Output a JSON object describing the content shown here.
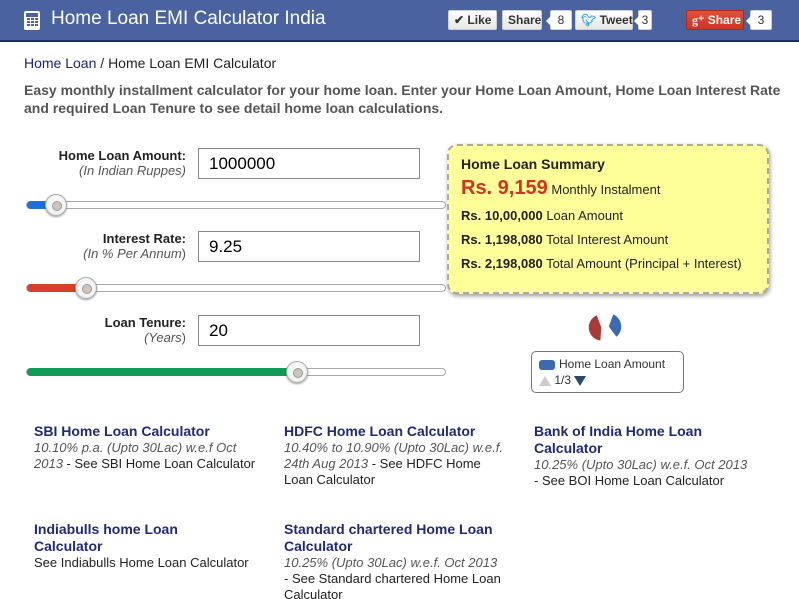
{
  "header": {
    "title": "Home Loan EMI Calculator India",
    "icon": "calculator-icon",
    "social": {
      "like_label": "Like",
      "fb_share_label": "Share",
      "fb_count": "8",
      "tweet_label": "Tweet",
      "tweet_count": "3",
      "gplus_label": "Share",
      "gplus_count": "3"
    }
  },
  "breadcrumb": {
    "home": "Home Loan",
    "separator": " / ",
    "current": "Home Loan EMI Calculator"
  },
  "intro": "Easy monthly installment calculator for your home loan. Enter your Home Loan Amount, Home Loan Interest Rate and required Loan Tenure to see detail home loan calculations.",
  "fields": {
    "amount": {
      "label": "Home Loan Amount:",
      "sub": "(In Indian Ruppes)",
      "value": "1000000",
      "slider_fraction": 0.07,
      "color": "#1e6fd9"
    },
    "rate": {
      "label": "Interest Rate:",
      "sub_pre": "(In % Per Annum",
      "sub_post": ")",
      "value": "9.25",
      "slider_fraction": 0.14,
      "color": "#d9402b"
    },
    "tenure": {
      "label": "Loan Tenure:",
      "sub_pre": "(Years",
      "sub_post": ")",
      "value": "20",
      "slider_fraction": 0.645,
      "color": "#0e9c57"
    }
  },
  "summary": {
    "title": "Home Loan Summary",
    "emi": "Rs. 9,159",
    "emi_label": "Monthly Instalment",
    "loan_amount": "Rs. 10,00,000",
    "loan_amount_label": "Loan Amount",
    "interest": "Rs. 1,198,080",
    "interest_label": "Total Interest Amount",
    "total": "Rs. 2,198,080",
    "total_label": "Total Amount (Principal + Interest)"
  },
  "chart_data": {
    "type": "pie",
    "title": "",
    "series": [
      {
        "name": "Home Loan Amount",
        "value": 1000000,
        "color": "#3c6ab0"
      },
      {
        "name": "Total Interest Amount",
        "value": 1198080,
        "color": "#aa3a3a"
      }
    ],
    "legend": {
      "visible_entry": "Home Loan Amount",
      "page": "1/3",
      "placement": "bottom"
    }
  },
  "banks": [
    {
      "title": "SBI Home Loan Calculator",
      "rate": "10.10% p.a. (Upto 30Lac) w.e.f Oct 2013",
      "see": " - See SBI Home Loan Calculator"
    },
    {
      "title": "HDFC Home Loan Calculator",
      "rate": "10.40% to 10.90% (Upto 30Lac) w.e.f. 24th Aug 2013",
      "see": " - See HDFC Home Loan Calculator"
    },
    {
      "title": "Bank of India Home Loan Calculator",
      "rate": "10.25% (Upto 30Lac) w.e.f. Oct 2013",
      "see": " - See BOI Home Loan Calculator"
    },
    {
      "title": "Indiabulls home Loan Calculator",
      "rate": "",
      "see": "See Indiabulls Home Loan Calculator"
    },
    {
      "title": "Standard chartered Home Loan Calculator",
      "rate": "10.25% (Upto 30Lac) w.e.f. Oct 2013",
      "see": " - See Standard chartered Home Loan Calculator"
    }
  ]
}
